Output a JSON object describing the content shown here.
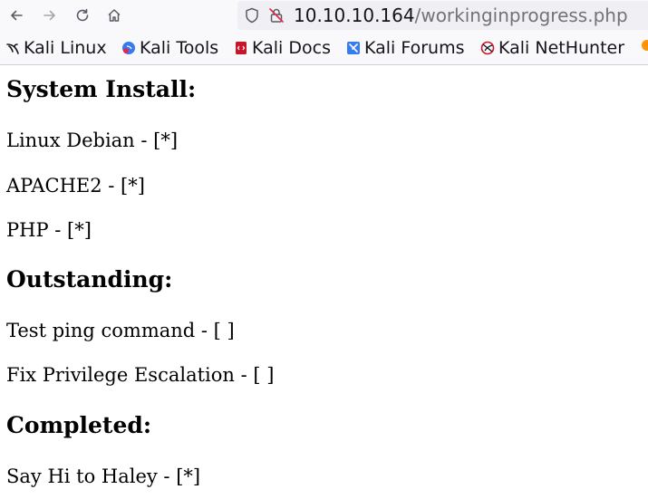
{
  "browser": {
    "url_host": "10.10.10.164",
    "url_path": "/workinginprogress.php",
    "nav_icons": [
      "back-arrow-icon",
      "forward-arrow-icon",
      "reload-icon",
      "home-icon"
    ],
    "url_icons": [
      "shield-icon",
      "insecure-lock-icon"
    ]
  },
  "bookmarks": {
    "items": [
      {
        "label": "Kali Linux",
        "icon": "kali-dragon-icon"
      },
      {
        "label": "Kali Tools",
        "icon": "kali-tools-icon"
      },
      {
        "label": "Kali Docs",
        "icon": "kali-docs-icon"
      },
      {
        "label": "Kali Forums",
        "icon": "kali-forums-icon"
      },
      {
        "label": "Kali NetHunter",
        "icon": "kali-nethunter-icon"
      }
    ]
  },
  "page": {
    "sections": [
      {
        "heading": "System Install:",
        "items": [
          "Linux Debian - [*]",
          "APACHE2 - [*]",
          "PHP - [*]"
        ]
      },
      {
        "heading": "Outstanding:",
        "items": [
          "Test ping command - [ ]",
          "Fix Privilege Escalation - [ ]"
        ]
      },
      {
        "heading": "Completed:",
        "items": [
          "Say Hi to Haley - [*]"
        ]
      }
    ]
  },
  "colors": {
    "chrome_bg": "#f9f9fb",
    "urlbar_bg": "#f0f0f4",
    "url_path": "#737373",
    "insecure_red": "#e22850"
  }
}
